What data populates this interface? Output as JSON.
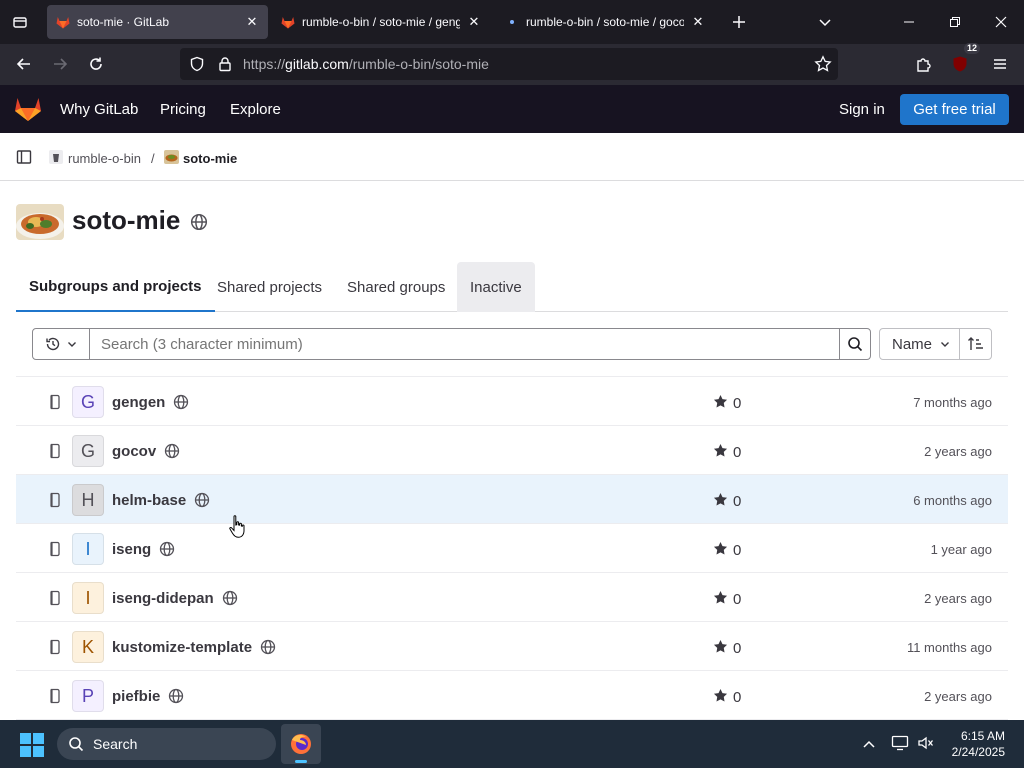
{
  "browser": {
    "tabs": [
      {
        "title": "soto-mie · GitLab",
        "active": true
      },
      {
        "title": "rumble-o-bin / soto-mie / gengen",
        "active": false
      },
      {
        "title": "rumble-o-bin / soto-mie / gocov",
        "active": false
      }
    ],
    "url_prefix": "https://",
    "url_host": "gitlab.com",
    "url_path": "/rumble-o-bin/soto-mie",
    "extension_badge": "12"
  },
  "gitlab_header": {
    "why": "Why GitLab",
    "pricing": "Pricing",
    "explore": "Explore",
    "sign_in": "Sign in",
    "trial": "Get free trial"
  },
  "breadcrumb": {
    "parent": "rumble-o-bin",
    "separator": "/",
    "current": "soto-mie"
  },
  "group": {
    "title": "soto-mie"
  },
  "tabs": {
    "subgroups": "Subgroups and projects",
    "shared_projects": "Shared projects",
    "shared_groups": "Shared groups",
    "inactive": "Inactive"
  },
  "filter": {
    "search_placeholder": "Search (3 character minimum)",
    "sort_label": "Name"
  },
  "projects": [
    {
      "initial": "G",
      "name": "gengen",
      "stars": "0",
      "updated": "7 months ago",
      "avatar_bg": "#f4f0ff",
      "avatar_fg": "#5943b6"
    },
    {
      "initial": "G",
      "name": "gocov",
      "stars": "0",
      "updated": "2 years ago",
      "avatar_bg": "#ececef",
      "avatar_fg": "#535158"
    },
    {
      "initial": "H",
      "name": "helm-base",
      "stars": "0",
      "updated": "6 months ago",
      "avatar_bg": "#dcdcde",
      "avatar_fg": "#535158"
    },
    {
      "initial": "I",
      "name": "iseng",
      "stars": "0",
      "updated": "1 year ago",
      "avatar_bg": "#e9f3fc",
      "avatar_fg": "#1f75cb"
    },
    {
      "initial": "I",
      "name": "iseng-didepan",
      "stars": "0",
      "updated": "2 years ago",
      "avatar_bg": "#fdf1dd",
      "avatar_fg": "#9e5400"
    },
    {
      "initial": "K",
      "name": "kustomize-template",
      "stars": "0",
      "updated": "11 months ago",
      "avatar_bg": "#fdf1dd",
      "avatar_fg": "#9e5400"
    },
    {
      "initial": "P",
      "name": "piefbie",
      "stars": "0",
      "updated": "2 years ago",
      "avatar_bg": "#f4f0ff",
      "avatar_fg": "#5943b6"
    }
  ],
  "taskbar": {
    "search": "Search",
    "time": "6:15 AM",
    "date": "2/24/2025"
  },
  "colors": {
    "accent": "#1f75cb",
    "header_bg": "#171321",
    "row_highlight": "#e9f3fc"
  }
}
